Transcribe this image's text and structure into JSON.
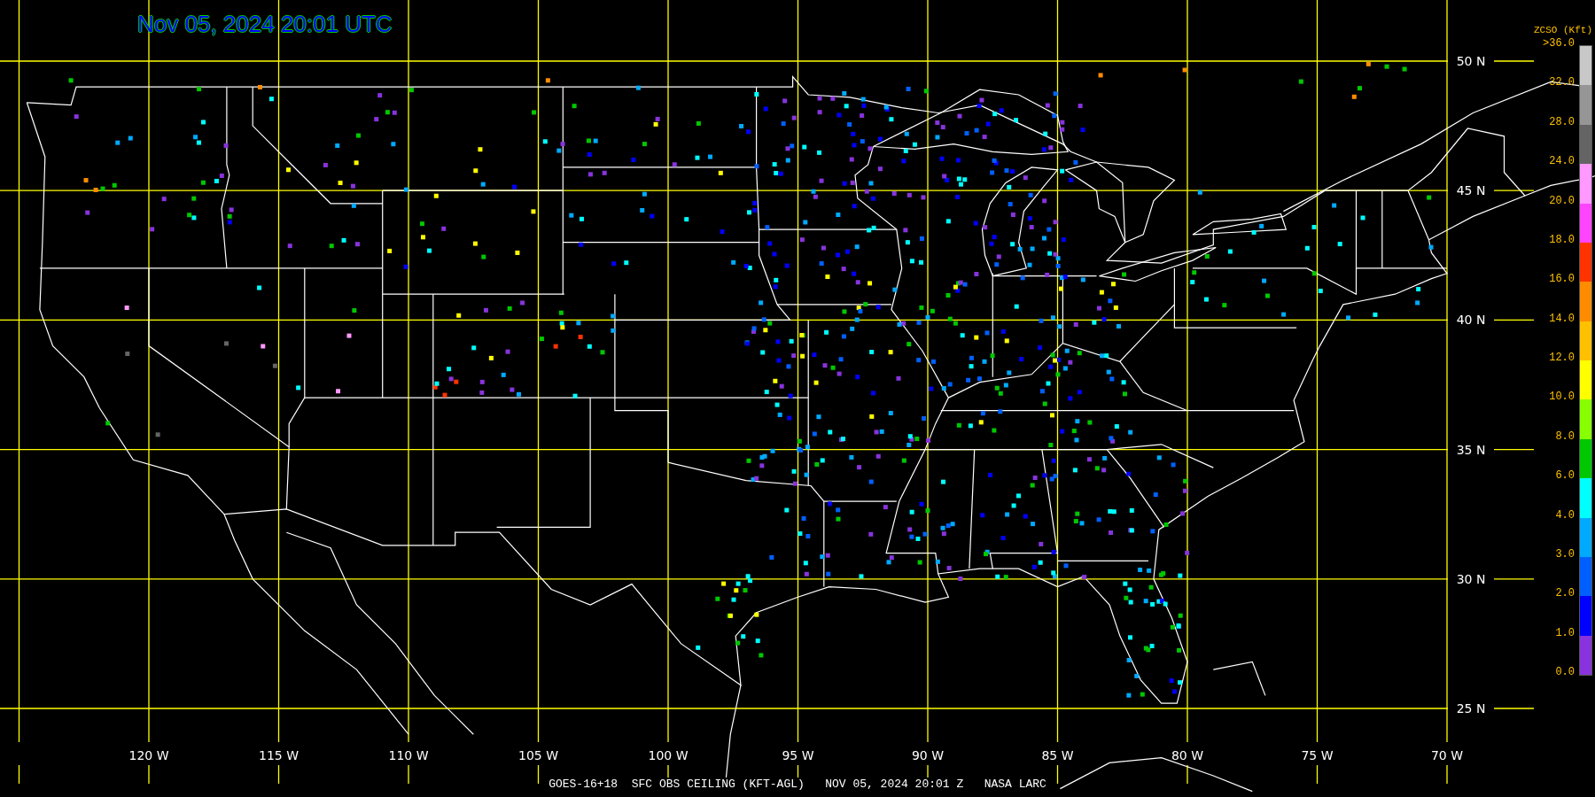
{
  "title": "Nov 05, 2024 20:01 UTC",
  "map": {
    "lat_labels": [
      "50 N",
      "45 N",
      "40 N",
      "35 N",
      "30 N",
      "25 N"
    ],
    "lon_labels": [
      "120 W",
      "115 W",
      "110 W",
      "105 W",
      "100 W",
      "95 W",
      "90 W",
      "85 W",
      "80 W",
      "75 W",
      "70 W"
    ]
  },
  "legend": {
    "title": "ZCSO (Kft)",
    "labels": [
      ">36.0",
      "32.0",
      "28.0",
      "24.0",
      "20.0",
      "18.0",
      "16.0",
      "14.0",
      "12.0",
      "10.0",
      "8.0",
      "6.0",
      "4.0",
      "3.0",
      "2.0",
      "1.0",
      "0.0"
    ],
    "bins": [
      {
        "color": "#c8c8c8"
      },
      {
        "color": "#969696"
      },
      {
        "color": "#646464"
      },
      {
        "color": "#ff99ff"
      },
      {
        "color": "#ff44ff"
      },
      {
        "color": "#ff3300"
      },
      {
        "color": "#ff8c00"
      },
      {
        "color": "#ffc000"
      },
      {
        "color": "#ffff00"
      },
      {
        "color": "#88ff00"
      },
      {
        "color": "#00c800"
      },
      {
        "color": "#00ffff"
      },
      {
        "color": "#00aaff"
      },
      {
        "color": "#0060ff"
      },
      {
        "color": "#0000ff"
      },
      {
        "color": "#8833dd"
      }
    ]
  },
  "footer": "GOES-16+18  SFC OBS CEILING (KFT-AGL)   NOV 05, 2024 20:01 Z   NASA LARC"
}
